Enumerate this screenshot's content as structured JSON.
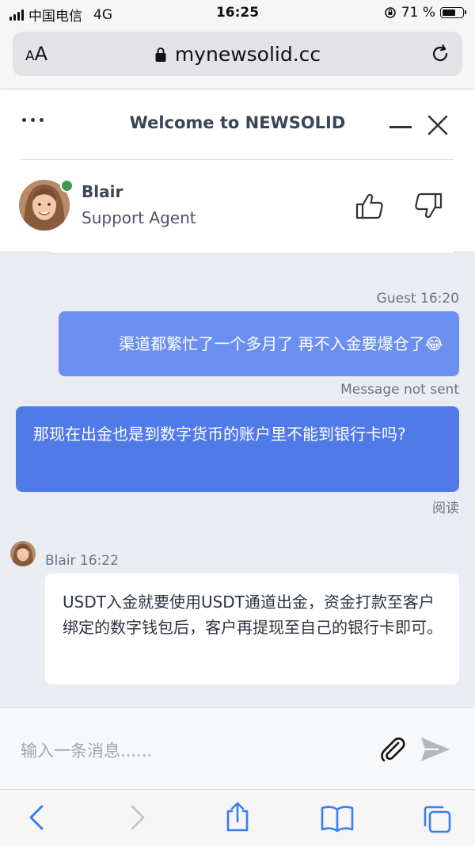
{
  "status_bar": {
    "carrier": "中国电信",
    "network": "4G",
    "time": "16:25",
    "battery": "71 %",
    "battery_level": 0.71
  },
  "browser": {
    "text_size_label_small": "A",
    "text_size_label_large": "A",
    "url": "mynewsolid.cc"
  },
  "chat": {
    "title": "Welcome to NEWSOLID",
    "agent": {
      "name": "Blair",
      "role": "Support Agent",
      "status": "online",
      "status_color": "#3e9b54"
    },
    "messages": [
      {
        "sender": "guest",
        "meta": "Guest 16:20",
        "text": "渠道都繁忙了一个多月了 再不入金要爆仓了😂",
        "footer": "Message not sent"
      },
      {
        "sender": "guest",
        "meta": "",
        "text": "那现在出金也是到数字货币的账户里不能到银行卡吗?",
        "footer": "阅读"
      },
      {
        "sender": "agent",
        "meta": "Blair 16:22",
        "text": "USDT入金就要使用USDT通道出金，资金打款至客户绑定的数字钱包后，客户再提现至自己的银行卡即可。",
        "footer": ""
      }
    ],
    "input_placeholder": "输入一条消息......"
  },
  "colors": {
    "guest_bubble_unsent": "#6a8ff0",
    "guest_bubble": "#507ae8",
    "agent_bubble": "#ffffff",
    "chat_background": "#e9ecf2"
  },
  "toolbar": {
    "icons": [
      "back-icon",
      "forward-icon",
      "share-icon",
      "bookmarks-icon",
      "tabs-icon"
    ]
  }
}
